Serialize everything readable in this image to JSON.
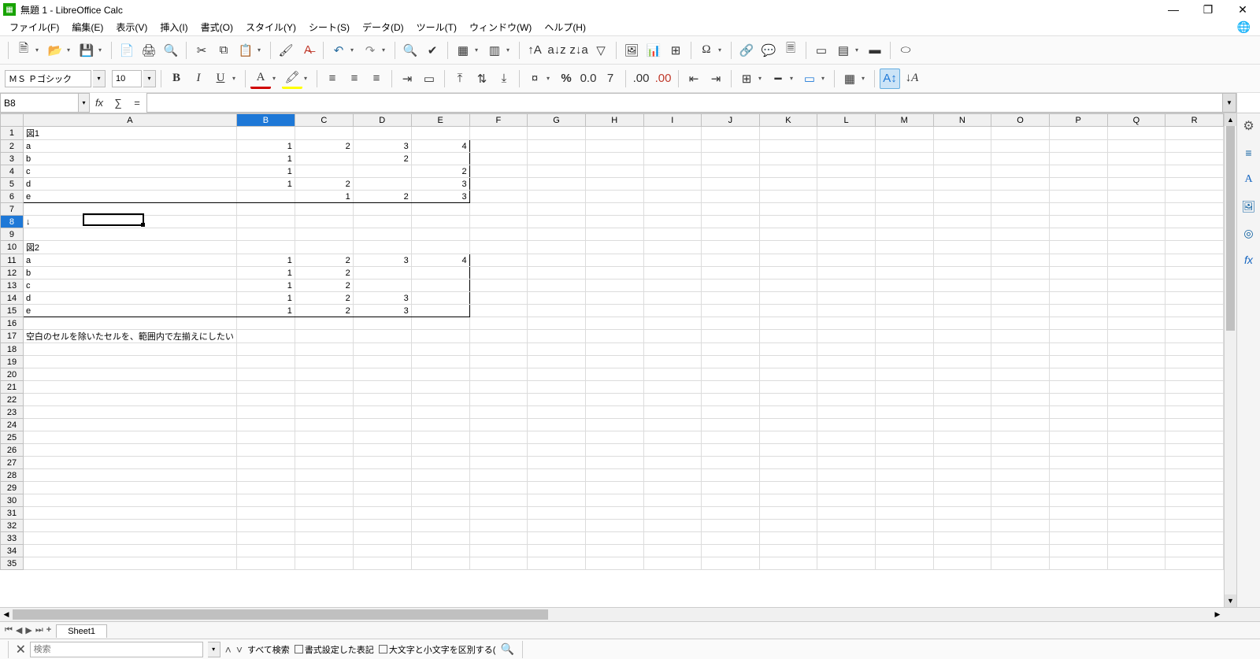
{
  "title": "無題 1 - LibreOffice Calc",
  "window_controls": {
    "min": "—",
    "max": "❐",
    "close": "✕"
  },
  "menus": [
    "ファイル(F)",
    "編集(E)",
    "表示(V)",
    "挿入(I)",
    "書式(O)",
    "スタイル(Y)",
    "シート(S)",
    "データ(D)",
    "ツール(T)",
    "ウィンドウ(W)",
    "ヘルプ(H)"
  ],
  "font": {
    "name": "ＭＳ Ｐゴシック",
    "size": "10"
  },
  "name_box": "B8",
  "formula_input": "",
  "columns": [
    "A",
    "B",
    "C",
    "D",
    "E",
    "F",
    "G",
    "H",
    "I",
    "J",
    "K",
    "L",
    "M",
    "N",
    "O",
    "P",
    "Q",
    "R"
  ],
  "selected_column": "B",
  "selected_row": 8,
  "row_count": 35,
  "cells": {
    "1": {
      "A": "図1"
    },
    "2": {
      "A": "a",
      "B": "1",
      "C": "2",
      "D": "3",
      "E": "4"
    },
    "3": {
      "A": "b",
      "B": "1",
      "D": "2"
    },
    "4": {
      "A": "c",
      "B": "1",
      "E": "2"
    },
    "5": {
      "A": "d",
      "B": "1",
      "C": "2",
      "E": "3"
    },
    "6": {
      "A": "e",
      "C": "1",
      "D": "2",
      "E": "3"
    },
    "8": {
      "A": "↓"
    },
    "10": {
      "A": "図2"
    },
    "11": {
      "A": "a",
      "B": "1",
      "C": "2",
      "D": "3",
      "E": "4"
    },
    "12": {
      "A": "b",
      "B": "1",
      "C": "2"
    },
    "13": {
      "A": "c",
      "B": "1",
      "C": "2"
    },
    "14": {
      "A": "d",
      "B": "1",
      "C": "2",
      "D": "3"
    },
    "15": {
      "A": "e",
      "B": "1",
      "C": "2",
      "D": "3"
    },
    "17": {
      "A": "空白のセルを除いたセルを、範囲内で左揃えにしたい"
    }
  },
  "numeric_cols": [
    "B",
    "C",
    "D",
    "E"
  ],
  "border_regions": [
    {
      "r1": 2,
      "r2": 6,
      "c1": "A",
      "c2": "E"
    },
    {
      "r1": 11,
      "r2": 15,
      "c1": "A",
      "c2": "E"
    }
  ],
  "sheet_tab": "Sheet1",
  "findbar": {
    "placeholder": "検索",
    "find_all": "すべて検索",
    "chk1": "書式設定した表記",
    "chk2": "大文字と小文字を区別する("
  },
  "sidepanel_icons": [
    "⚙",
    "≡",
    "A",
    "🖼",
    "◎",
    "fx"
  ]
}
